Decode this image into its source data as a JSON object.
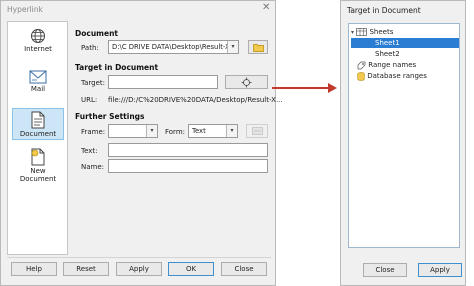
{
  "hyperlink": {
    "title": "Hyperlink",
    "sidebar": [
      {
        "label": "Internet",
        "icon": "globe-icon"
      },
      {
        "label": "Mail",
        "icon": "mail-icon"
      },
      {
        "label": "Document",
        "icon": "document-icon",
        "selected": true
      },
      {
        "label": "New Document",
        "icon": "new-document-icon"
      }
    ],
    "document_section": "Document",
    "path_label": "Path:",
    "path_value": "D:\\C DRIVE DATA\\Desktop\\Result-X-A.o",
    "target_section": "Target in Document",
    "target_label": "Target:",
    "target_value": "",
    "url_label": "URL:",
    "url_value": "file:///D:/C%20DRIVE%20DATA/Desktop/Result-X...",
    "further_section": "Further Settings",
    "frame_label": "Frame:",
    "frame_value": "",
    "form_label": "Form:",
    "form_value": "Text",
    "text_label": "Text:",
    "text_value": "",
    "name_label": "Name:",
    "name_value": "",
    "buttons": {
      "help": "Help",
      "reset": "Reset",
      "apply": "Apply",
      "ok": "OK",
      "close": "Close"
    }
  },
  "target_dialog": {
    "title": "Target in Document",
    "tree": [
      {
        "label": "Sheets",
        "level": 0,
        "icon": "table-icon"
      },
      {
        "label": "Sheet1",
        "level": 1,
        "selected": true
      },
      {
        "label": "Sheet2",
        "level": 1
      },
      {
        "label": "Range names",
        "level": 0,
        "icon": "range-names-icon"
      },
      {
        "label": "Database ranges",
        "level": 0,
        "icon": "database-icon"
      }
    ],
    "buttons": {
      "close": "Close",
      "apply": "Apply"
    }
  },
  "colors": {
    "selection": "#2b7cd3",
    "arrow": "#c0392b",
    "default_button_border": "#3f8fcf"
  }
}
